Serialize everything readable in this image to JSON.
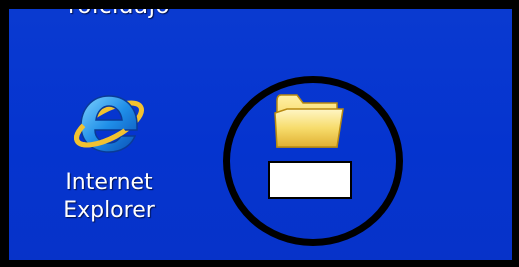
{
  "desktop": {
    "partial_label": "roicidajo",
    "icons": [
      {
        "label_line1": "Internet",
        "label_line2": "Explorer",
        "icon": "internet-explorer-icon"
      },
      {
        "label": "",
        "icon": "folder-icon",
        "state": "renaming"
      }
    ]
  },
  "rename": {
    "value": ""
  },
  "colors": {
    "desktop_background": "#0534cf",
    "highlight_circle": "#000000",
    "label_text": "#ffffff"
  }
}
